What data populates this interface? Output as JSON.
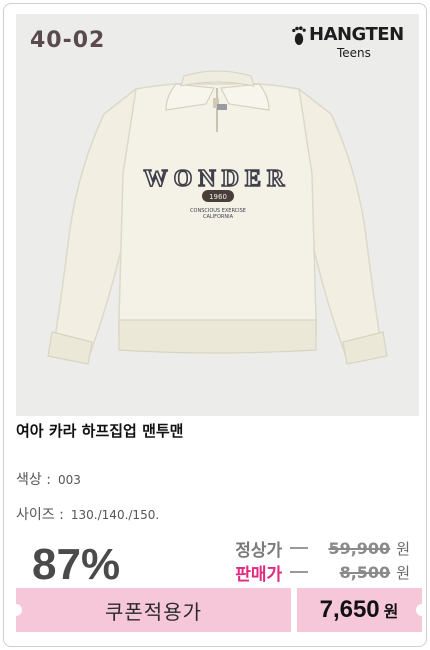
{
  "badge": {
    "code": "40-02"
  },
  "brand": {
    "name": "HANGTEN",
    "sub": "Teens",
    "logo_icon": "footprint-icon"
  },
  "product": {
    "title": "여아 카라 하프집업 맨투맨",
    "graphic": {
      "line1": "WONDER",
      "line2": "1960",
      "line3": "CONSCIOUS EXERCISE",
      "line4": "CALIFORNIA"
    }
  },
  "specs": {
    "color_label": "색상 :",
    "color_value": "003",
    "size_label": "사이즈 :",
    "size_value": "130./140./150."
  },
  "price": {
    "discount": "87%",
    "regular_label": "정상가",
    "regular_amount": "59,900",
    "sale_label": "판매가",
    "sale_amount": "8,500",
    "won": "원",
    "coupon_label": "쿠폰적용가",
    "coupon_amount": "7,650"
  },
  "colors": {
    "sale_label": "#e0297f",
    "coupon_bar": "#f6c7d8",
    "garment": "#f2efe2"
  }
}
